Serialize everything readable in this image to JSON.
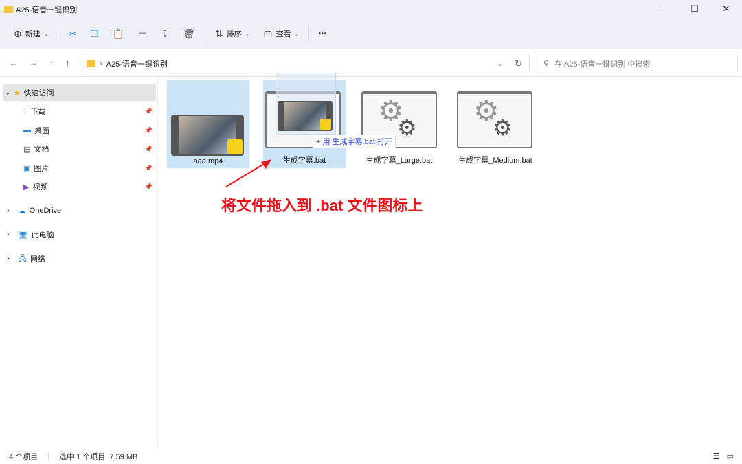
{
  "window": {
    "title": "A25-语音一键识别",
    "minimize": "—",
    "maximize": "☐",
    "close": "✕"
  },
  "toolbar": {
    "new_label": "新建",
    "sort_label": "排序",
    "view_label": "查看",
    "more": "···"
  },
  "nav": {
    "back": "←",
    "forward": "→",
    "recent": "⌄",
    "up": "↑",
    "breadcrumb": "A25-语音一键识别",
    "search_placeholder": "在 A25-语音一键识别 中搜索"
  },
  "sidebar": {
    "quick_access": "快速访问",
    "items": [
      {
        "label": "下载"
      },
      {
        "label": "桌面"
      },
      {
        "label": "文档"
      },
      {
        "label": "图片"
      },
      {
        "label": "视频"
      }
    ],
    "onedrive": "OneDrive",
    "this_pc": "此电脑",
    "network": "网络"
  },
  "files": [
    {
      "name": "aaa.mp4",
      "selected": true
    },
    {
      "name": "生成字幕.bat",
      "selected": true
    },
    {
      "name": "生成字幕_Large.bat",
      "selected": false
    },
    {
      "name": "生成字幕_Medium.bat",
      "selected": false
    }
  ],
  "drag_tooltip": "+ 用 生成字幕.bat 打开",
  "annotation": "将文件拖入到 .bat 文件图标上",
  "status": {
    "count": "4 个项目",
    "selection": "选中 1 个项目  7.59 MB"
  },
  "colors": {
    "accent": "#2b7bd6",
    "selection": "#cce4f7",
    "annotation": "#e8141b"
  }
}
